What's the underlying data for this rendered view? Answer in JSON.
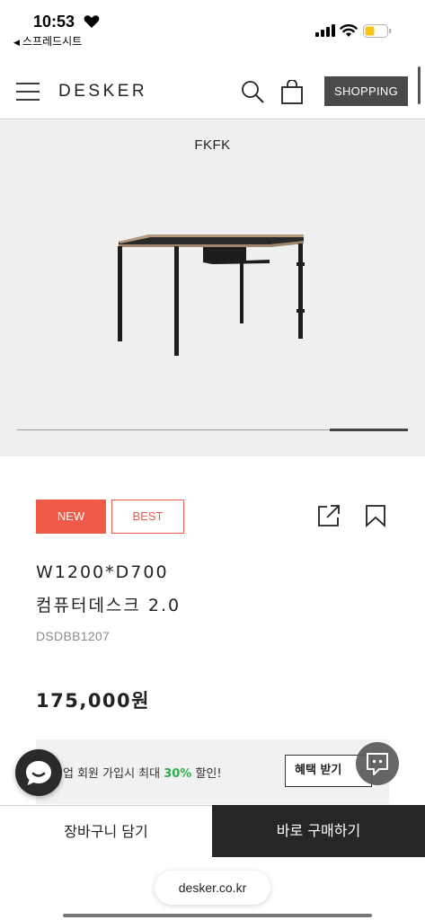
{
  "status": {
    "time": "10:53",
    "back_label": "스프레드시트"
  },
  "header": {
    "logo": "DESKER",
    "shopping_label": "SHOPPING"
  },
  "hero": {
    "brand": "FKFK",
    "slide_index": 5,
    "slide_count": 5
  },
  "product": {
    "badges": [
      "NEW",
      "BEST"
    ],
    "title_line1": "W1200*D700",
    "title_line2": "컴퓨터데스크 2.0",
    "code": "DSDBB1207",
    "price": "175,000원"
  },
  "promo": {
    "text_before": "업 회원 가입시 최대 ",
    "highlight": "30%",
    "text_after": " 할인!",
    "button_label": "혜택 받기",
    "button_chevron": "›"
  },
  "actions": {
    "cart_label": "장바구니 담기",
    "buy_label": "바로 구매하기"
  },
  "browser": {
    "url": "desker.co.kr"
  },
  "colors": {
    "accent": "#f05a48",
    "promo_highlight": "#2bb14f",
    "dark": "#262626"
  },
  "icons": [
    "heart-icon",
    "back-arrow-icon",
    "signal-icon",
    "wifi-icon",
    "battery-icon",
    "menu-icon",
    "search-icon",
    "shopping-bag-icon",
    "share-icon",
    "bookmark-icon",
    "chat-bubble-icon",
    "talk-icon"
  ]
}
